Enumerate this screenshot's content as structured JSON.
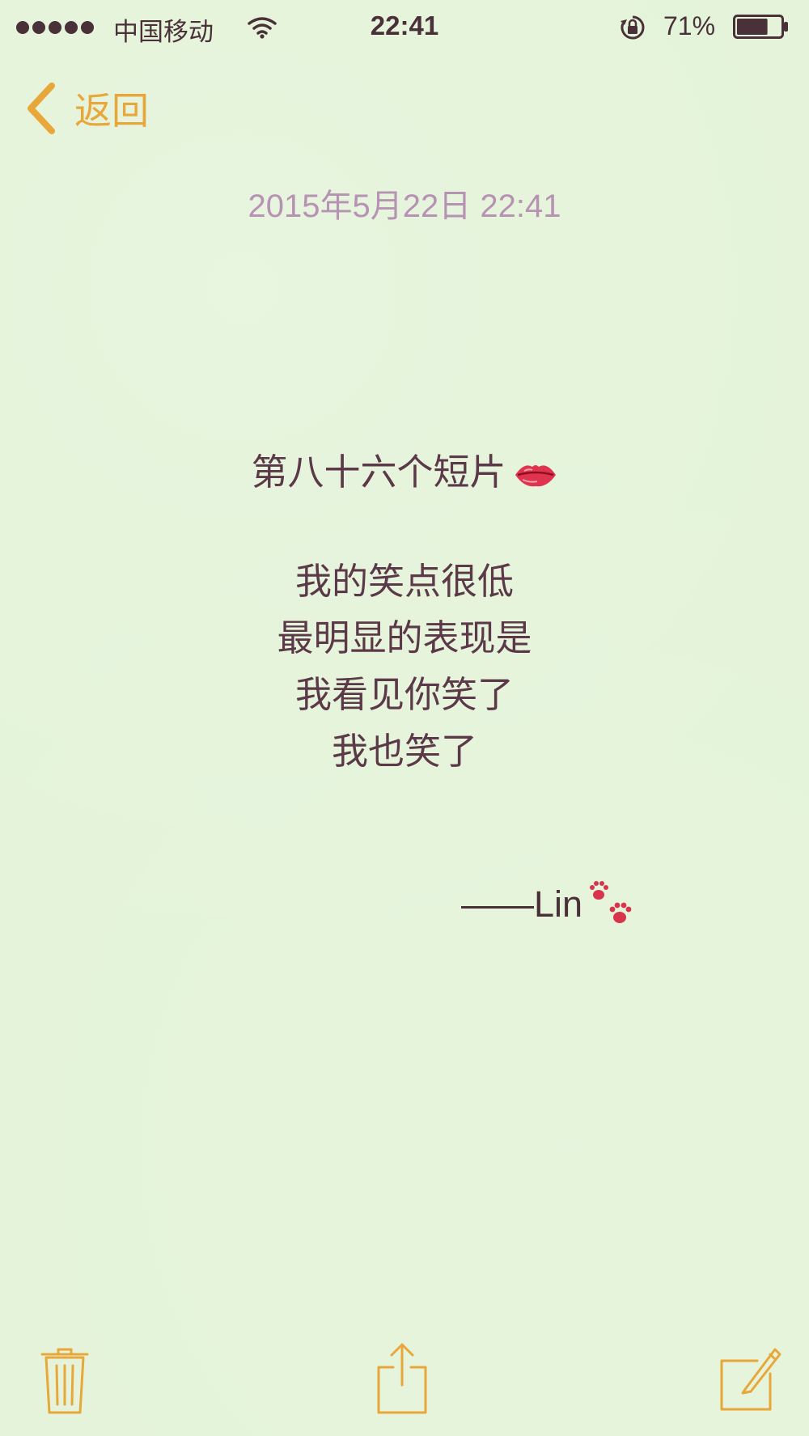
{
  "status_bar": {
    "carrier": "中国移动",
    "time": "22:41",
    "battery_percent": "71%",
    "battery_level": 0.71,
    "signal_bars": 5,
    "icons": [
      "signal-dots-icon",
      "wifi-icon",
      "rotation-lock-icon",
      "battery-icon"
    ]
  },
  "nav": {
    "back_label": "返回",
    "back_icon": "chevron-left-icon",
    "accent_color": "#e8a73a"
  },
  "note": {
    "date": "2015年5月22日 22:41",
    "title": "第八十六个短片",
    "title_emoji": "lips-icon",
    "lines": [
      "我的笑点很低",
      "最明显的表现是",
      "我看见你笑了",
      "我也笑了"
    ],
    "signature": "——Lin",
    "signature_emoji": "paw-prints-icon",
    "text_color": "#5b3948",
    "date_color": "#b793b3"
  },
  "toolbar": {
    "items": [
      "trash-icon",
      "share-icon",
      "compose-icon"
    ]
  },
  "colors": {
    "background": "#e3f3d8"
  }
}
